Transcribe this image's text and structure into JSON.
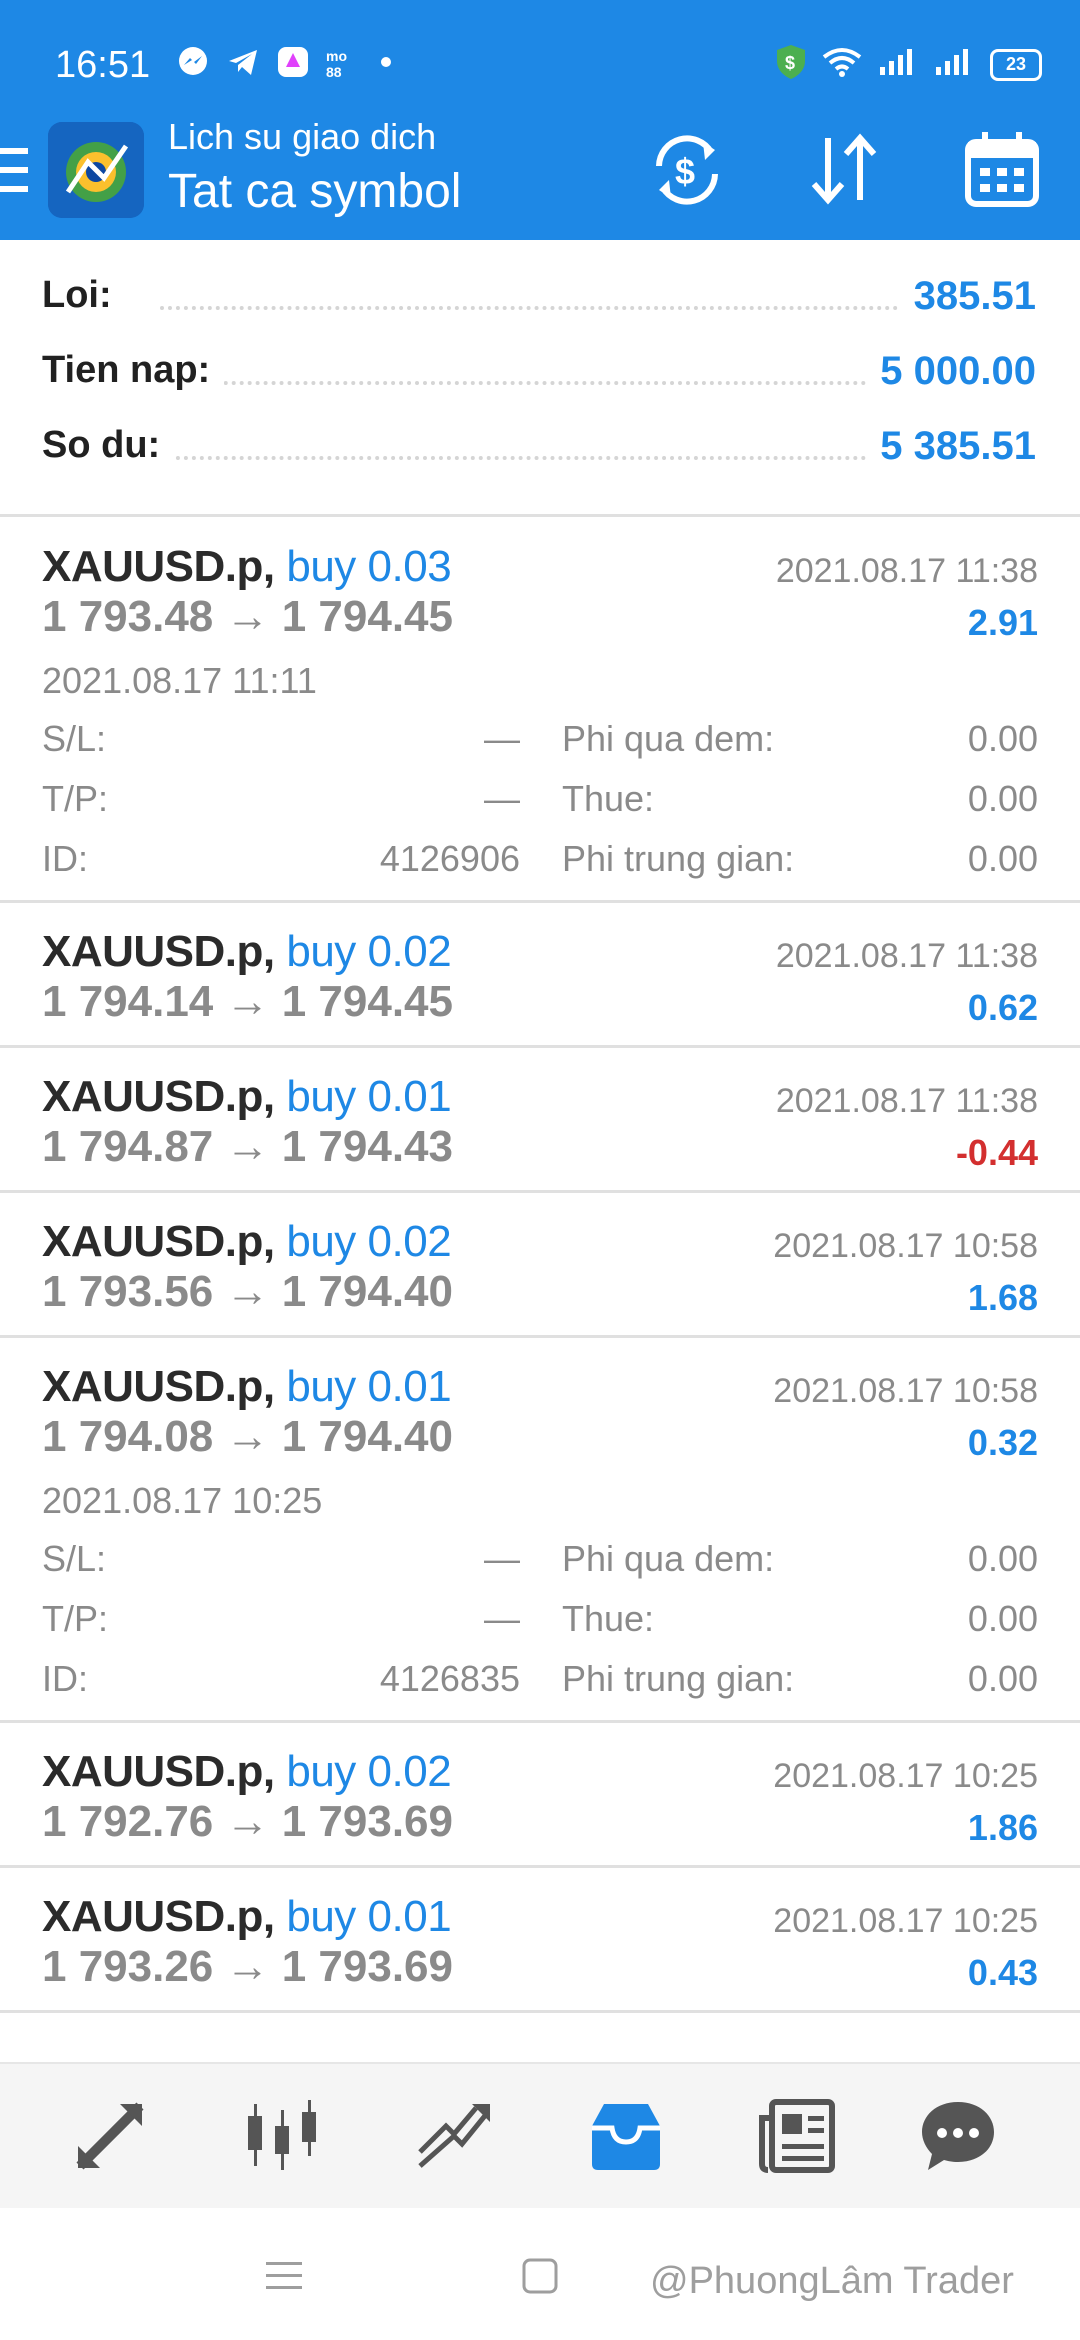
{
  "status_bar": {
    "time": "16:51",
    "left_icons": [
      "messenger-icon",
      "telegram-icon",
      "app-shortcut-icon",
      "mxo-icon"
    ],
    "battery": "23"
  },
  "toolbar": {
    "subtitle": "Lich su giao dich",
    "title": "Tat ca symbol",
    "actions": [
      "currency-exchange-icon",
      "sort-icon",
      "calendar-icon"
    ]
  },
  "summary": [
    {
      "label": "Loi:",
      "value": "385.51"
    },
    {
      "label": "Tien nap:",
      "value": "5 000.00"
    },
    {
      "label": "So du:",
      "value": "5 385.51"
    }
  ],
  "detail_labels": {
    "sl": "S/L:",
    "tp": "T/P:",
    "id": "ID:",
    "swap": "Phi qua dem:",
    "tax": "Thue:",
    "commission": "Phi trung gian:"
  },
  "trades": [
    {
      "symbol": "XAUUSD.p,",
      "side": "buy 0.03",
      "prices": "1 793.48 → 1 794.45",
      "close_time": "2021.08.17 11:38",
      "profit": "2.91",
      "negative": false,
      "expanded": true,
      "open_time": "2021.08.17 11:11",
      "sl": "—",
      "tp": "—",
      "id": "4126906",
      "swap": "0.00",
      "tax": "0.00",
      "commission": "0.00"
    },
    {
      "symbol": "XAUUSD.p,",
      "side": "buy 0.02",
      "prices": "1 794.14 → 1 794.45",
      "close_time": "2021.08.17 11:38",
      "profit": "0.62",
      "negative": false,
      "expanded": false
    },
    {
      "symbol": "XAUUSD.p,",
      "side": "buy 0.01",
      "prices": "1 794.87 → 1 794.43",
      "close_time": "2021.08.17 11:38",
      "profit": "-0.44",
      "negative": true,
      "expanded": false
    },
    {
      "symbol": "XAUUSD.p,",
      "side": "buy 0.02",
      "prices": "1 793.56 → 1 794.40",
      "close_time": "2021.08.17 10:58",
      "profit": "1.68",
      "negative": false,
      "expanded": false
    },
    {
      "symbol": "XAUUSD.p,",
      "side": "buy 0.01",
      "prices": "1 794.08 → 1 794.40",
      "close_time": "2021.08.17 10:58",
      "profit": "0.32",
      "negative": false,
      "expanded": true,
      "open_time": "2021.08.17 10:25",
      "sl": "—",
      "tp": "—",
      "id": "4126835",
      "swap": "0.00",
      "tax": "0.00",
      "commission": "0.00"
    },
    {
      "symbol": "XAUUSD.p,",
      "side": "buy 0.02",
      "prices": "1 792.76 → 1 793.69",
      "close_time": "2021.08.17 10:25",
      "profit": "1.86",
      "negative": false,
      "expanded": false
    },
    {
      "symbol": "XAUUSD.p,",
      "side": "buy 0.01",
      "prices": "1 793.26 → 1 793.69",
      "close_time": "2021.08.17 10:25",
      "profit": "0.43",
      "negative": false,
      "expanded": false
    }
  ],
  "tabs": [
    {
      "name": "quotes-icon",
      "active": false
    },
    {
      "name": "chart-icon",
      "active": false
    },
    {
      "name": "trade-icon",
      "active": false
    },
    {
      "name": "history-icon",
      "active": true
    },
    {
      "name": "news-icon",
      "active": false
    },
    {
      "name": "chat-icon",
      "active": false
    }
  ],
  "colors": {
    "accent": "#1e88e5",
    "negative": "#d32f2f",
    "muted": "#8a8a8a"
  },
  "watermark": "@PhuongLâm Trader"
}
